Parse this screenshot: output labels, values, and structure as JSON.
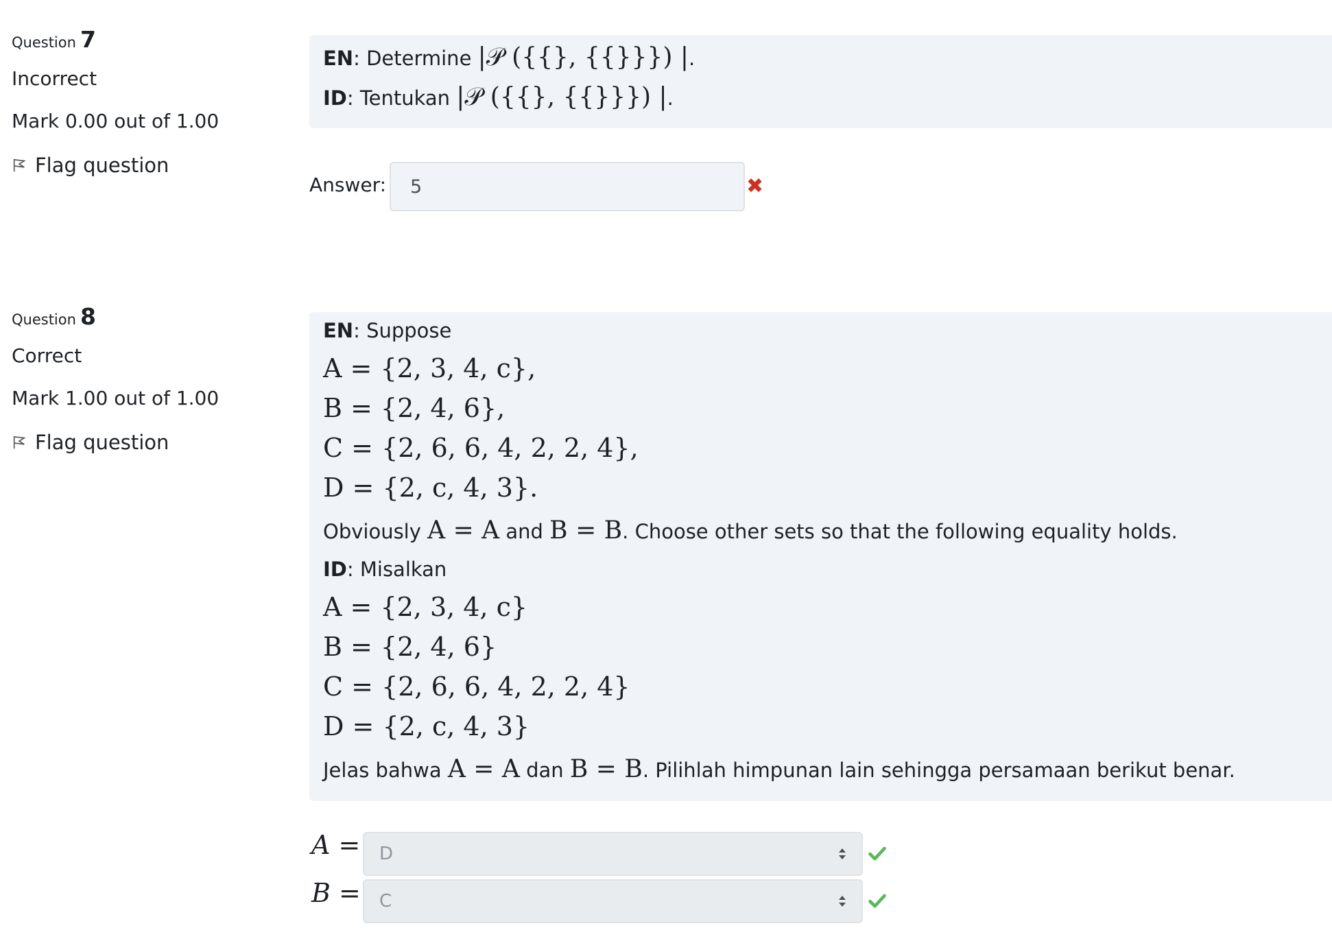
{
  "q7": {
    "head_prefix": "Question",
    "number": "7",
    "state": "Incorrect",
    "mark": "Mark 0.00 out of 1.00",
    "flag": "Flag question",
    "text": {
      "en_tag": "EN",
      "en_text": ": Determine ",
      "id_tag": "ID",
      "id_text": ": Tentukan ",
      "expression": "|𝒫 ({{}, {{}}}) |",
      "period": "."
    },
    "answer_label": "Answer:",
    "answer_value": "5",
    "answer_status_icon": "cross-icon"
  },
  "q8": {
    "head_prefix": "Question",
    "number": "8",
    "state": "Correct",
    "mark": "Mark 1.00 out of 1.00",
    "flag": "Flag question",
    "text": {
      "en_tag": "EN",
      "en_intro": ": Suppose",
      "en_sets": [
        "A = {2, 3, 4, c},",
        "B = {2, 4, 6},",
        "C = {2, 6, 6, 4, 2, 2, 4},",
        "D = {2, c, 4, 3}."
      ],
      "en_obvious_1": "Obviously ",
      "en_eq_a": "A = A",
      "en_and": " and ",
      "en_eq_b": "B = B",
      "en_rest": ". Choose other sets so that the following equality holds.",
      "id_tag": "ID",
      "id_intro": ": Misalkan",
      "id_sets": [
        "A = {2, 3, 4, c}",
        "B = {2, 4, 6}",
        "C = {2, 6, 6, 4, 2, 2, 4}",
        "D = {2, c, 4, 3}"
      ],
      "id_obvious_1": "Jelas bahwa ",
      "id_eq_a": "A = A",
      "id_and": " dan ",
      "id_eq_b": "B = B",
      "id_rest": ". Pilihlah himpunan lain sehingga persamaan berikut benar."
    },
    "selects": [
      {
        "label": "A =",
        "value": "D",
        "status_icon": "check-icon"
      },
      {
        "label": "B =",
        "value": "C",
        "status_icon": "check-icon"
      }
    ]
  },
  "colors": {
    "text": "#1d2125",
    "qtext_bg": "#f0f4f8",
    "incorrect": "#ca3120",
    "correct": "#357a32"
  }
}
